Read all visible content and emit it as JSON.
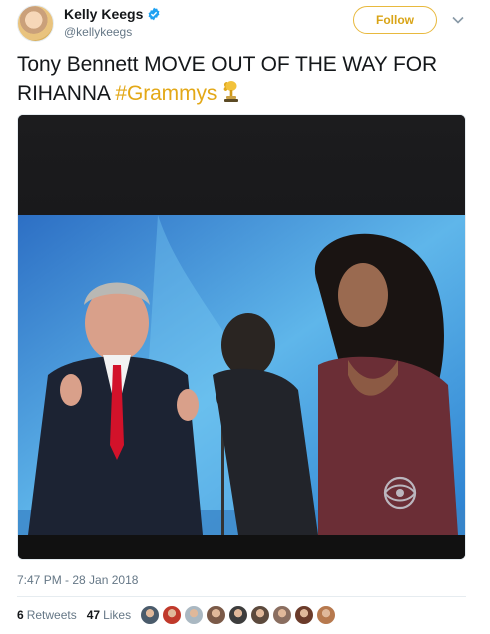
{
  "author": {
    "display_name": "Kelly Keegs",
    "handle": "@kellykeegs",
    "verified": true,
    "avatar_icon": "profile-photo"
  },
  "follow_button": {
    "label": "Follow",
    "color": "#d9a416"
  },
  "menu_icon": "chevron-down-icon",
  "tweet": {
    "text": "Tony Bennett MOVE OUT OF THE WAY FOR RIHANNA ",
    "hashtag": "#Grammys",
    "hashtag_color": "#e3a817",
    "emoji_icon": "grammy-trophy-icon"
  },
  "media": {
    "type": "photo",
    "description_icon": "tv-screen-photo",
    "watermark_icon": "cbs-eye-logo"
  },
  "timestamp": "7:47 PM - 28 Jan 2018",
  "stats": {
    "retweets_count": "6",
    "retweets_label": "Retweets",
    "likes_count": "47",
    "likes_label": "Likes"
  },
  "likers": [
    {
      "color": "#4a5b6b"
    },
    {
      "color": "#c0392b"
    },
    {
      "color": "#aab8c2"
    },
    {
      "color": "#7b5a48"
    },
    {
      "color": "#3d3d3d"
    },
    {
      "color": "#5c4a3d"
    },
    {
      "color": "#8a6e60"
    },
    {
      "color": "#6b3b2a"
    },
    {
      "color": "#b7794e"
    }
  ]
}
